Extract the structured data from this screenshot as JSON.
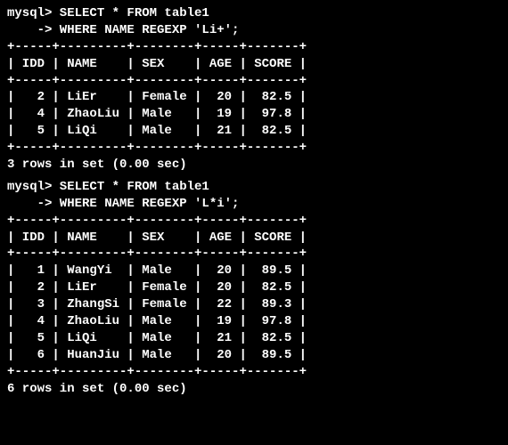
{
  "query1": {
    "prompt1": "mysql> SELECT * FROM table1",
    "prompt2": "    -> WHERE NAME REGEXP 'Li+';",
    "border": "+-----+---------+--------+-----+-------+",
    "header": "| IDD | NAME    | SEX    | AGE | SCORE |",
    "rows": [
      "|   2 | LiEr    | Female |  20 |  82.5 |",
      "|   4 | ZhaoLiu | Male   |  19 |  97.8 |",
      "|   5 | LiQi    | Male   |  21 |  82.5 |"
    ],
    "footer": "3 rows in set (0.00 sec)"
  },
  "query2": {
    "prompt1": "mysql> SELECT * FROM table1",
    "prompt2": "    -> WHERE NAME REGEXP 'L*i';",
    "border": "+-----+---------+--------+-----+-------+",
    "header": "| IDD | NAME    | SEX    | AGE | SCORE |",
    "rows": [
      "|   1 | WangYi  | Male   |  20 |  89.5 |",
      "|   2 | LiEr    | Female |  20 |  82.5 |",
      "|   3 | ZhangSi | Female |  22 |  89.3 |",
      "|   4 | ZhaoLiu | Male   |  19 |  97.8 |",
      "|   5 | LiQi    | Male   |  21 |  82.5 |",
      "|   6 | HuanJiu | Male   |  20 |  89.5 |"
    ],
    "footer": "6 rows in set (0.00 sec)"
  }
}
